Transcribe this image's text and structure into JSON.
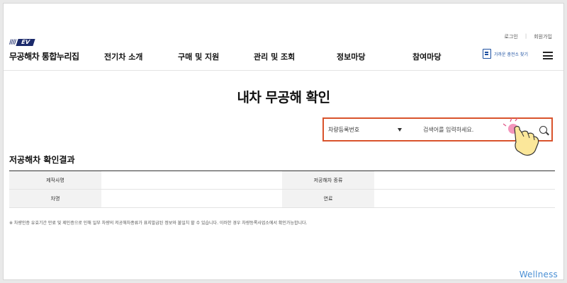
{
  "header": {
    "logo_stripes": "////",
    "logo_badge": "EV",
    "site_name": "무공해차 통합누리집",
    "top_links": {
      "login": "로그인",
      "sep": "|",
      "signup": "회원가입"
    },
    "nav": [
      "전기차 소개",
      "구매 및 지원",
      "관리 및 조회",
      "정보마당",
      "참여마당"
    ],
    "find_btn": "가까운 충전소 찾기"
  },
  "page_title": "내차 무공해 확인",
  "search": {
    "select_value": "차량등록번호",
    "placeholder": "검색어를 입력하세요."
  },
  "result": {
    "title": "저공해차 확인결과",
    "rows": [
      {
        "label1": "제작사명",
        "value1": "",
        "label2": "저공해차 종류",
        "value2": ""
      },
      {
        "label1": "차명",
        "value1": "",
        "label2": "연료",
        "value2": ""
      }
    ],
    "notice": "※ 차량인증 유효기간 만료 및 제인증으로 인해 일부 차량의 저공해차종류가 표지발급된 정보와 불일치 할 수 있습니다. 이러한 경우 차량등록사업소에서 확인가능합니다."
  },
  "watermark": "Wellness",
  "colors": {
    "highlight": "#d9532c",
    "brand": "#1b2a6b",
    "link": "#1b4fa0",
    "watermark": "#4a8fd4"
  },
  "icons": [
    "logo-icon",
    "charger-finder-icon",
    "menu-icon",
    "dropdown-caret-icon",
    "search-icon",
    "tap-hand-icon"
  ]
}
